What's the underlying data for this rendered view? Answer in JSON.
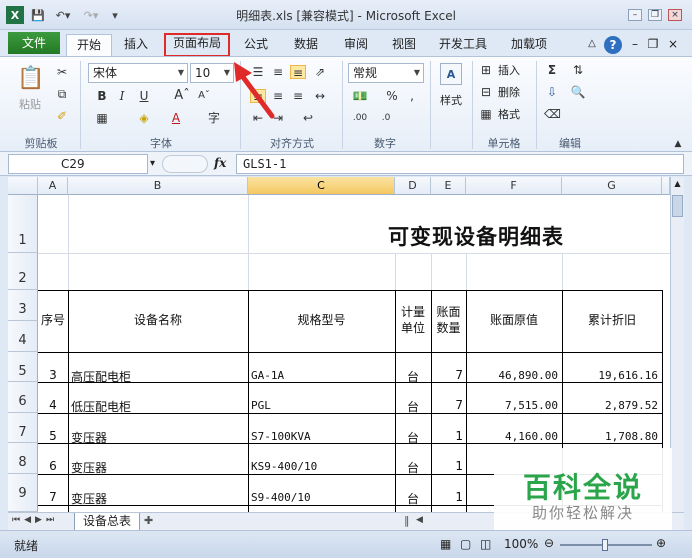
{
  "window": {
    "title": "明细表.xls  [兼容模式] - Microsoft Excel"
  },
  "tabs": {
    "file": "文件",
    "home": "开始",
    "insert": "插入",
    "page_layout": "页面布局",
    "formulas": "公式",
    "data": "数据",
    "review": "审阅",
    "view": "视图",
    "developer": "开发工具",
    "addins": "加载项"
  },
  "ribbon": {
    "clipboard": {
      "label": "剪贴板",
      "paste": "粘贴"
    },
    "font": {
      "label": "字体",
      "name": "宋体",
      "size": "10"
    },
    "alignment": {
      "label": "对齐方式"
    },
    "number": {
      "label": "数字",
      "format": "常规"
    },
    "styles": {
      "label": "样式"
    },
    "cells": {
      "label": "单元格",
      "insert": "插入",
      "delete": "删除",
      "format": "格式"
    },
    "editing": {
      "label": "编辑"
    }
  },
  "formula_bar": {
    "name_box": "C29",
    "fx": "fx",
    "content": "GLS1-1"
  },
  "sheet": {
    "columns": [
      "A",
      "B",
      "C",
      "D",
      "E",
      "F",
      "G"
    ],
    "active_column": "C",
    "row_numbers": [
      "1",
      "2",
      "3",
      "4",
      "5",
      "6",
      "7",
      "8",
      "9"
    ],
    "title": "可变现设备明细表",
    "headers": {
      "seq": "序号",
      "name": "设备名称",
      "model": "规格型号",
      "unit_1": "计量",
      "unit_2": "单位",
      "qty_1": "账面",
      "qty_2": "数量",
      "orig": "账面原值",
      "dep": "累计折旧"
    },
    "rows": [
      {
        "seq": "3",
        "name": "高压配电柜",
        "model": "GA-1A",
        "unit": "台",
        "qty": "7",
        "orig": "46,890.00",
        "dep": "19,616.16"
      },
      {
        "seq": "4",
        "name": "低压配电柜",
        "model": "PGL",
        "unit": "台",
        "qty": "7",
        "orig": "7,515.00",
        "dep": "2,879.52"
      },
      {
        "seq": "5",
        "name": "变压器",
        "model": "S7-100KVA",
        "unit": "台",
        "qty": "1",
        "orig": "4,160.00",
        "dep": "1,708.80"
      },
      {
        "seq": "6",
        "name": "变压器",
        "model": "KS9-400/10",
        "unit": "台",
        "qty": "1",
        "orig": "",
        "dep": ""
      },
      {
        "seq": "7",
        "name": "变压器",
        "model": "S9-400/10",
        "unit": "台",
        "qty": "1",
        "orig": "",
        "dep": ""
      }
    ]
  },
  "sheet_tabs": [
    "设备总表"
  ],
  "status": {
    "ready": "就绪",
    "zoom": "100%"
  },
  "watermark": {
    "main": "百科全说",
    "sub": "助你轻松解决"
  },
  "colors": {
    "file_tab": "#2f8a31",
    "highlight": "#e02a2a",
    "active_col": "#f4c860",
    "watermark": "#2aa54a"
  }
}
